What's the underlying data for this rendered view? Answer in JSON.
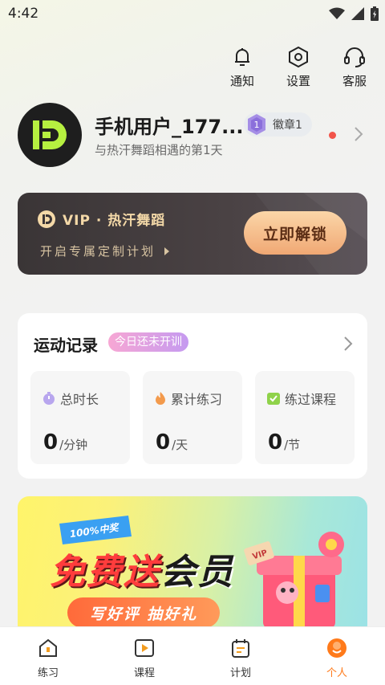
{
  "status_bar": {
    "time": "4:42",
    "icons": [
      "wifi-icon",
      "signal-icon",
      "battery-icon"
    ]
  },
  "top_actions": [
    {
      "label": "通知",
      "icon": "bell-icon"
    },
    {
      "label": "设置",
      "icon": "settings-hexagon-icon"
    },
    {
      "label": "客服",
      "icon": "headset-icon"
    }
  ],
  "profile": {
    "username": "手机用户_177...",
    "subtitle": "与热汗舞蹈相遇的第1天",
    "badge_label": "徽章1",
    "badge_level": "1"
  },
  "vip": {
    "title": "VIP · 热汗舞蹈",
    "description": "开启专属定制计划",
    "button_label": "立即解锁"
  },
  "record": {
    "title": "运动记录",
    "tag": "今日还未开训",
    "stats": [
      {
        "label": "总时长",
        "value": "0",
        "unit": "/分钟",
        "icon": "stopwatch-icon"
      },
      {
        "label": "累计练习",
        "value": "0",
        "unit": "/天",
        "icon": "flame-icon"
      },
      {
        "label": "练过课程",
        "value": "0",
        "unit": "/节",
        "icon": "check-icon"
      }
    ]
  },
  "promo": {
    "badge": "100%中奖",
    "headline_red": "免费送",
    "headline_black": "会员",
    "subline": "写好评 抽好礼",
    "vip_tag": "VIP"
  },
  "tabbar": [
    {
      "label": "练习",
      "icon": "house-icon",
      "active": false
    },
    {
      "label": "课程",
      "icon": "play-icon",
      "active": false
    },
    {
      "label": "计划",
      "icon": "calendar-icon",
      "active": false
    },
    {
      "label": "个人",
      "icon": "person-icon",
      "active": true
    }
  ],
  "colors": {
    "accent": "#ff7a1a",
    "vip_gold": "#f4d9a8",
    "notice_dot": "#f2544a"
  }
}
